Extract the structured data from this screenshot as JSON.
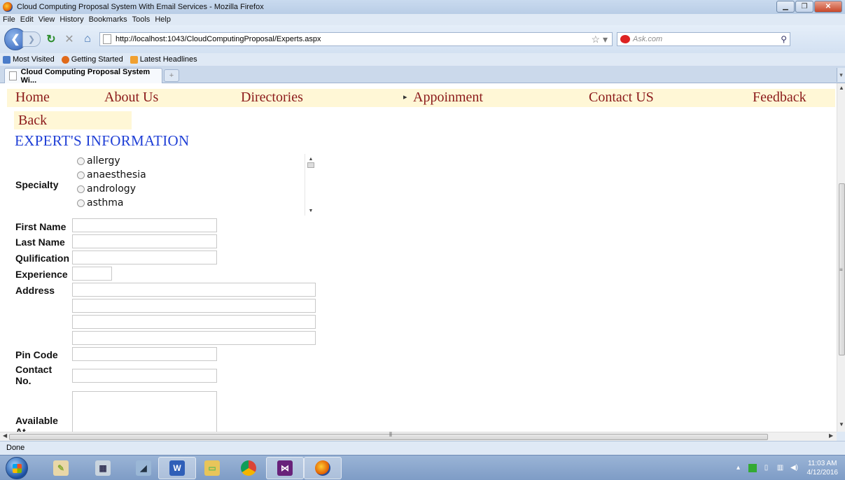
{
  "window": {
    "title": "Cloud Computing Proposal System With Email Services - Mozilla Firefox"
  },
  "menu": [
    "File",
    "Edit",
    "View",
    "History",
    "Bookmarks",
    "Tools",
    "Help"
  ],
  "address": {
    "url": "http://localhost:1043/CloudComputingProposal/Experts.aspx"
  },
  "search": {
    "placeholder": "Ask.com"
  },
  "bookmarks": [
    "Most Visited",
    "Getting Started",
    "Latest Headlines"
  ],
  "tab": {
    "title": "Cloud Computing Proposal System Wi..."
  },
  "nav": {
    "home": "Home",
    "about": "About Us",
    "directories": "Directories",
    "appointment": "Appoinment",
    "contact": "Contact US",
    "feedback": "Feedback"
  },
  "back_link": "Back",
  "heading": "EXPERT'S INFORMATION",
  "form": {
    "specialty_label": "Specialty",
    "specialties": [
      "allergy",
      "anaesthesia",
      "andrology",
      "asthma"
    ],
    "first_name_label": "First Name",
    "last_name_label": "Last Name",
    "qualification_label": "Qulification",
    "experience_label": "Experience",
    "address_label": "Address",
    "pin_label": "Pin Code",
    "contact_label": "Contact No.",
    "available_label": "Available At"
  },
  "status": {
    "text": "Done"
  },
  "clock": {
    "time": "11:03 AM",
    "date": "4/12/2016"
  },
  "colors": {
    "nav_bg": "#fff7d6",
    "nav_link": "#8b1a1a",
    "heading": "#1f3fd6"
  }
}
